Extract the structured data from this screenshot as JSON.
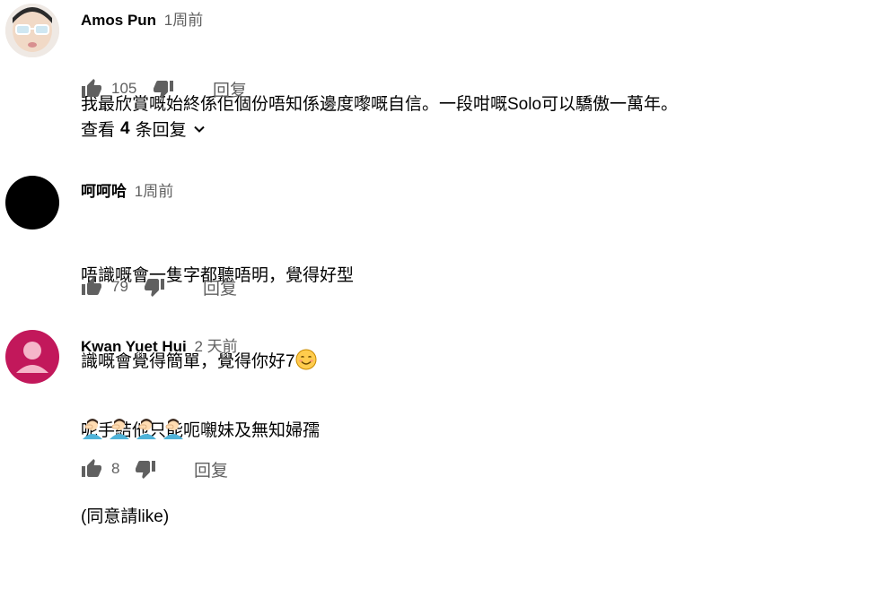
{
  "comments": [
    {
      "author": "Amos Pun",
      "time": "1周前",
      "lines": [
        "我最欣賞嘅始終係佢個份唔知係邊度嚟嘅自信。一段咁嘅Solo可以驕傲一萬年。"
      ],
      "likes": "105",
      "reply_label": "回复",
      "view_replies": {
        "prefix": "查看",
        "count": "4",
        "suffix": "条回复"
      }
    },
    {
      "author": "呵呵哈",
      "time": "1周前",
      "lines": [
        "唔識嘅會一隻字都聽唔明，覺得好型",
        "識嘅會覺得簡單，覺得你好7"
      ],
      "likes": "79",
      "reply_label": "回复"
    },
    {
      "author": "Kwan Yuet Hui",
      "time": "2 天前",
      "lines": [
        "呢手結他只能呃嚫妹及無知婦孺",
        "(同意請like)"
      ],
      "likes": "8",
      "reply_label": "回复"
    }
  ],
  "icons": {
    "like": "thumb-up-icon",
    "dislike": "thumb-down-icon",
    "expand": "chevron-down-icon",
    "smile": "smiling-face-emoji",
    "facepalm": "person-facepalming-emoji"
  },
  "colors": {
    "text": "#030303",
    "secondary": "#606060",
    "avatar_pink": "#c2185b"
  }
}
